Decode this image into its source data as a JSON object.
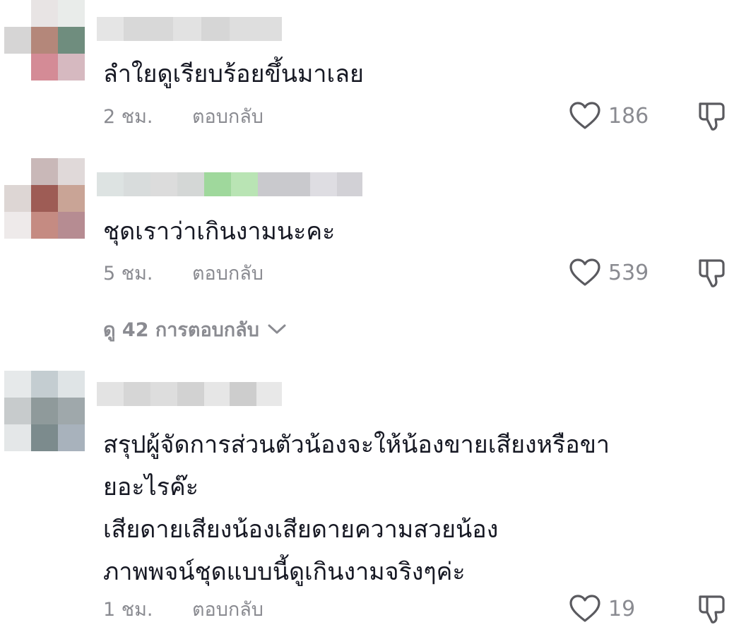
{
  "comments": [
    {
      "text": [
        "ลำใยดูเรียบร้อยขึ้นมาเลย"
      ],
      "time": "2 ชม.",
      "reply_label": "ตอบกลับ",
      "likes": "186"
    },
    {
      "text": [
        "ชุดเราว่าเกินงามนะคะ"
      ],
      "time": "5 ชม.",
      "reply_label": "ตอบกลับ",
      "likes": "539"
    },
    {
      "text": [
        "สรุปผู้จัดการส่วนตัวน้องจะให้น้องขายเสียงหรือขา",
        "ยอะไรค๊ะ",
        "เสียดายเสียงน้องเสียดายความสวยน้อง",
        "ภาพพจน์ชุดแบบนี้ดูเกินงามจริงๆค่ะ"
      ],
      "time": "1 ชม.",
      "reply_label": "ตอบกลับ",
      "likes": "19"
    }
  ],
  "view_replies": {
    "label": "ดู 42 การตอบกลับ"
  },
  "colors": {
    "text": "#161823",
    "secondary": "#8a8b91",
    "icon": "#5a5a5f"
  },
  "icons": {
    "like": "heart-outline-icon",
    "dislike": "thumbs-down-outline-icon",
    "expand": "chevron-down-icon"
  }
}
